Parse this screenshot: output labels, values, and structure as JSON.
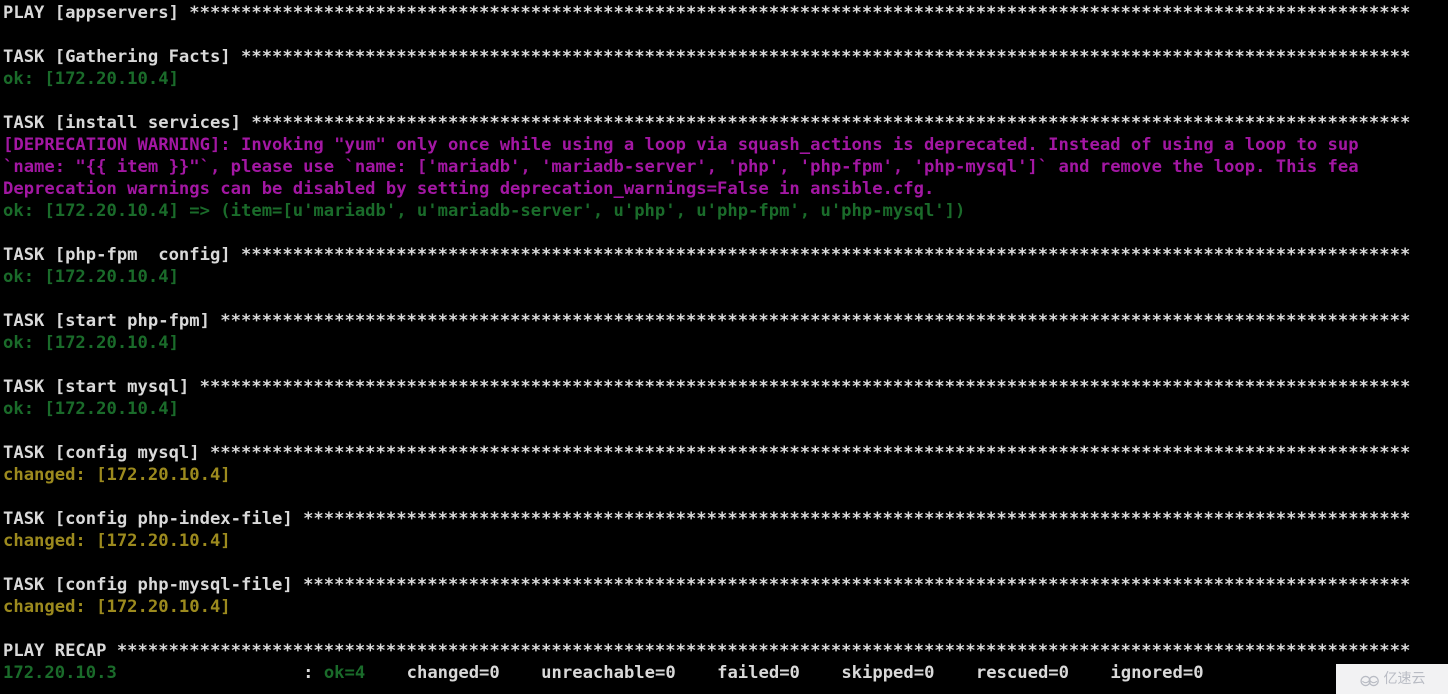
{
  "terminal": {
    "background_color": "#000000",
    "colors": {
      "default": "#d9d9d9",
      "ok": "#1a6b2a",
      "changed": "#9c8a1e",
      "deprecation": "#a317a3"
    },
    "lines": [
      {
        "text": "PLAY [appservers] **********************************************************************************************************************",
        "color": "default"
      },
      {
        "text": "",
        "color": "default"
      },
      {
        "text": "TASK [Gathering Facts] *****************************************************************************************************************",
        "color": "default"
      },
      {
        "text": "ok: [172.20.10.4]",
        "color": "ok"
      },
      {
        "text": "",
        "color": "default"
      },
      {
        "text": "TASK [install services] ****************************************************************************************************************",
        "color": "default"
      },
      {
        "text": "[DEPRECATION WARNING]: Invoking \"yum\" only once while using a loop via squash_actions is deprecated. Instead of using a loop to sup",
        "color": "deprecation"
      },
      {
        "text": "`name: \"{{ item }}\"`, please use `name: ['mariadb', 'mariadb-server', 'php', 'php-fpm', 'php-mysql']` and remove the loop. This fea",
        "color": "deprecation"
      },
      {
        "text": "Deprecation warnings can be disabled by setting deprecation_warnings=False in ansible.cfg.",
        "color": "deprecation"
      },
      {
        "text": "ok: [172.20.10.4] => (item=[u'mariadb', u'mariadb-server', u'php', u'php-fpm', u'php-mysql'])",
        "color": "ok"
      },
      {
        "text": "",
        "color": "default"
      },
      {
        "text": "TASK [php-fpm  config] *****************************************************************************************************************",
        "color": "default"
      },
      {
        "text": "ok: [172.20.10.4]",
        "color": "ok"
      },
      {
        "text": "",
        "color": "default"
      },
      {
        "text": "TASK [start php-fpm] *******************************************************************************************************************",
        "color": "default"
      },
      {
        "text": "ok: [172.20.10.4]",
        "color": "ok"
      },
      {
        "text": "",
        "color": "default"
      },
      {
        "text": "TASK [start mysql] *********************************************************************************************************************",
        "color": "default"
      },
      {
        "text": "ok: [172.20.10.4]",
        "color": "ok"
      },
      {
        "text": "",
        "color": "default"
      },
      {
        "text": "TASK [config mysql] ********************************************************************************************************************",
        "color": "default"
      },
      {
        "text": "changed: [172.20.10.4]",
        "color": "changed"
      },
      {
        "text": "",
        "color": "default"
      },
      {
        "text": "TASK [config php-index-file] ***********************************************************************************************************",
        "color": "default"
      },
      {
        "text": "changed: [172.20.10.4]",
        "color": "changed"
      },
      {
        "text": "",
        "color": "default"
      },
      {
        "text": "TASK [config php-mysql-file] ***********************************************************************************************************",
        "color": "default"
      },
      {
        "text": "changed: [172.20.10.4]",
        "color": "changed"
      },
      {
        "text": "",
        "color": "default"
      },
      {
        "text": "PLAY RECAP *****************************************************************************************************************************",
        "color": "default"
      }
    ],
    "recap": {
      "host": "172.20.10.3",
      "separator": ":",
      "ok": "ok=4",
      "changed": "changed=0",
      "unreachable": "unreachable=0",
      "failed": "failed=0",
      "skipped": "skipped=0",
      "rescued": "rescued=0",
      "ignored": "ignored=0"
    }
  },
  "watermark": {
    "icon": "cloud-icon",
    "text": "亿速云"
  }
}
